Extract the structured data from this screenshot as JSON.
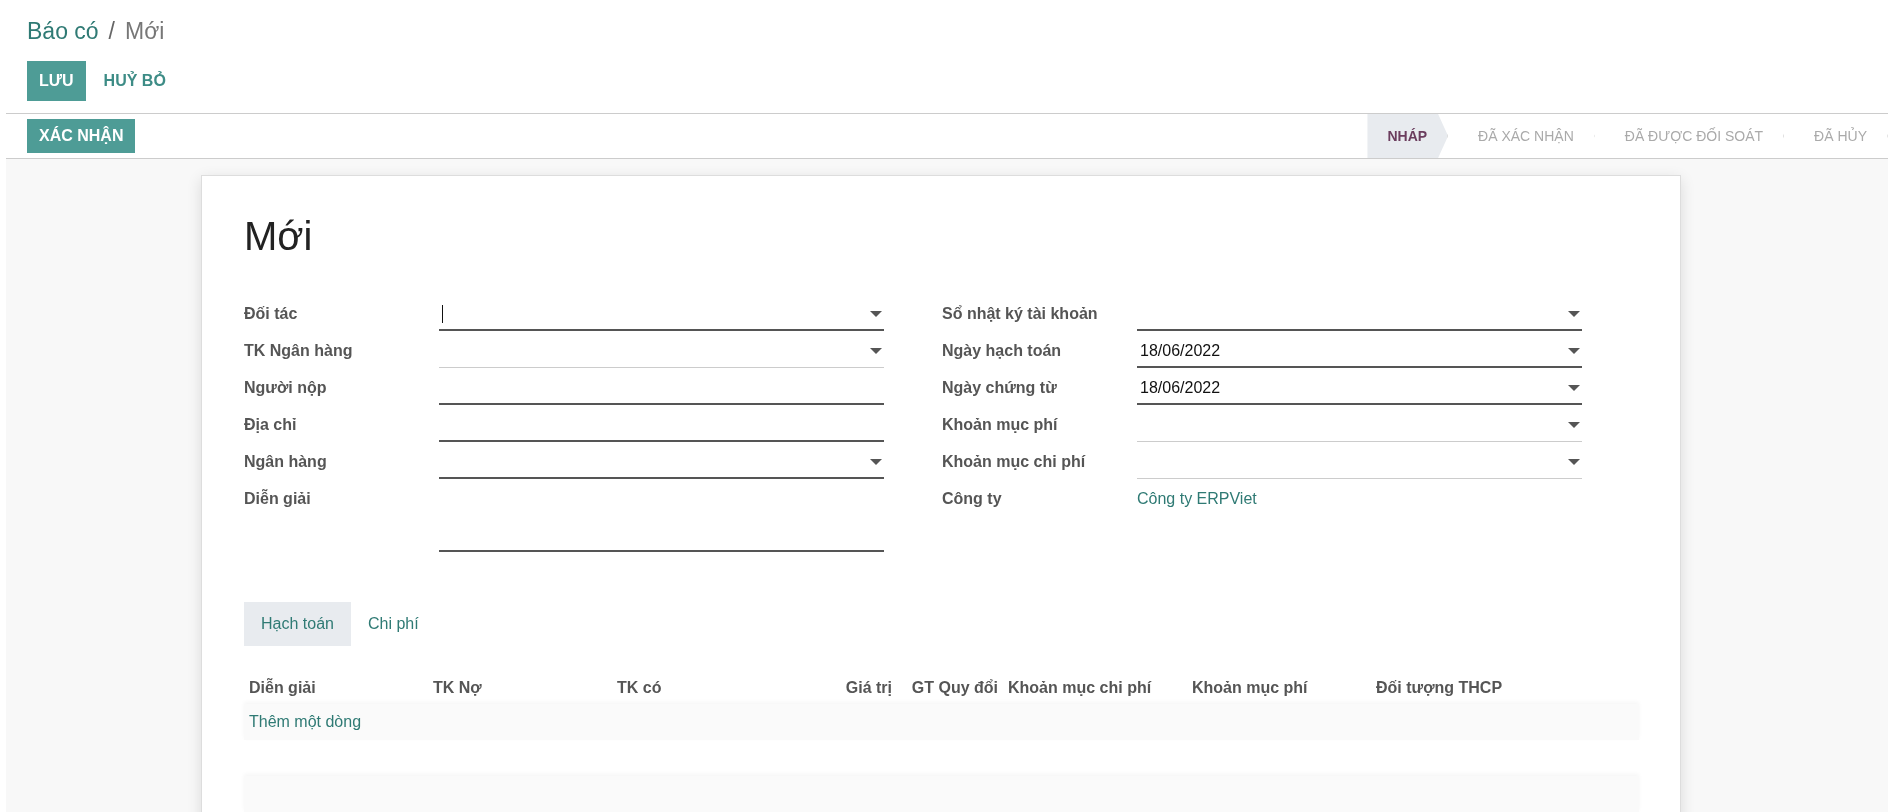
{
  "breadcrumb": {
    "parent": "Báo có",
    "separator": "/",
    "current": "Mới"
  },
  "buttons": {
    "save": "LƯU",
    "discard": "HUỶ BỎ"
  },
  "action_button": "XÁC NHẬN",
  "statusbar": [
    {
      "label": "NHÁP",
      "selected": true
    },
    {
      "label": "ĐÃ XÁC NHẬN",
      "selected": false
    },
    {
      "label": "ĐÃ ĐƯỢC ĐỐI SOÁT",
      "selected": false
    },
    {
      "label": "ĐÃ HỦY",
      "selected": false
    }
  ],
  "title": "Mới",
  "left_fields": [
    {
      "label": "Đối tác",
      "kind": "dropdown",
      "required": true,
      "focused": true
    },
    {
      "label": "TK Ngân hàng",
      "kind": "dropdown",
      "required": false,
      "focused": false
    },
    {
      "label": "Người nộp",
      "kind": "text",
      "required": true,
      "focused": false
    },
    {
      "label": "Địa chỉ",
      "kind": "text",
      "required": true,
      "focused": false
    },
    {
      "label": "Ngân hàng",
      "kind": "dropdown",
      "required": true,
      "focused": false
    },
    {
      "label": "Diễn giải",
      "kind": "textarea",
      "required": true,
      "focused": false
    }
  ],
  "right_fields": [
    {
      "label": "Sổ nhật ký tài khoản",
      "kind": "dropdown",
      "required": true,
      "focused": false
    },
    {
      "label": "Ngày hạch toán",
      "kind": "dropdown",
      "required": true,
      "focused": false,
      "value": "18/06/2022"
    },
    {
      "label": "Ngày chứng từ",
      "kind": "dropdown",
      "required": true,
      "focused": false,
      "value": "18/06/2022"
    },
    {
      "label": "Khoản mục phí",
      "kind": "dropdown",
      "required": false,
      "focused": false
    },
    {
      "label": "Khoản mục chi phí",
      "kind": "dropdown",
      "required": false,
      "focused": false
    },
    {
      "label": "Công ty",
      "kind": "link",
      "value": "Công ty ERPViet"
    }
  ],
  "tabs": [
    {
      "label": "Hạch toán",
      "selected": true
    },
    {
      "label": "Chi phí",
      "selected": false
    }
  ],
  "table": {
    "columns": [
      {
        "label": "Diễn giải",
        "numeric": false
      },
      {
        "label": "TK Nợ",
        "numeric": false
      },
      {
        "label": "TK có",
        "numeric": false
      },
      {
        "label": "Giá trị",
        "numeric": true
      },
      {
        "label": "GT Quy đổi",
        "numeric": true
      },
      {
        "label": "Khoản mục chi phí",
        "numeric": false
      },
      {
        "label": "Khoản mục phí",
        "numeric": false
      },
      {
        "label": "Đối tượng THCP",
        "numeric": false
      }
    ],
    "add_line": "Thêm một dòng"
  }
}
